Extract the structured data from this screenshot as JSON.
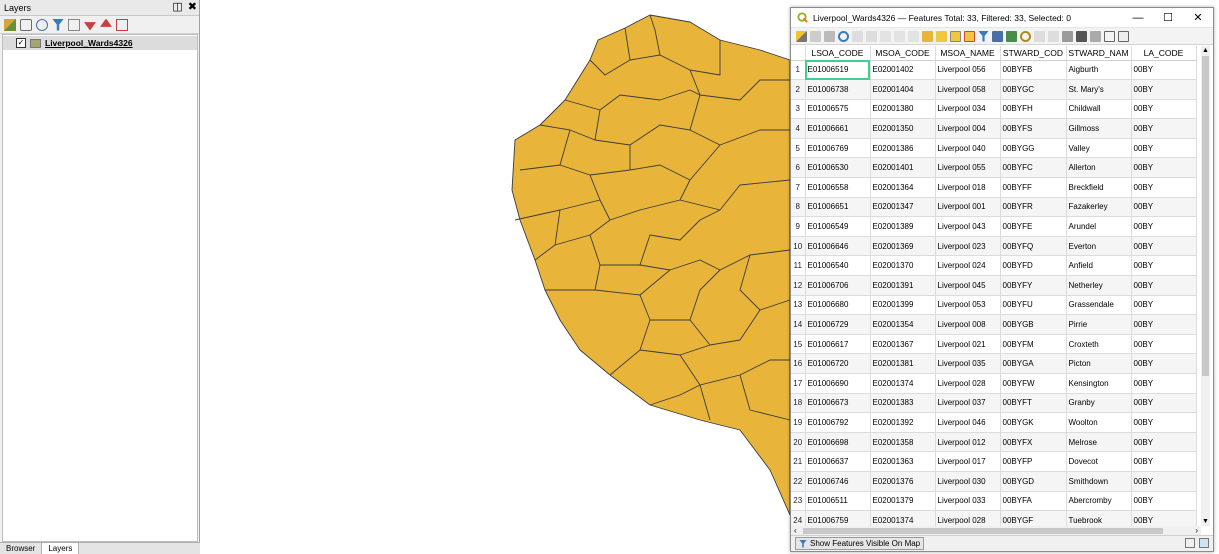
{
  "layers_panel": {
    "title": "Layers",
    "layer_name": "Liverpool_Wards4326",
    "tabs": [
      "Browser",
      "Layers"
    ]
  },
  "attribute_table": {
    "title": "Liverpool_Wards4326 — Features Total: 33, Filtered: 33, Selected: 0",
    "columns": [
      "LSOA_CODE",
      "MSOA_CODE",
      "MSOA_NAME",
      "STWARD_COD",
      "STWARD_NAM",
      "LA_CODE"
    ],
    "rows": [
      [
        "1",
        "E01006519",
        "E02001402",
        "Liverpool 056",
        "00BYFB",
        "Aigburth",
        "00BY"
      ],
      [
        "2",
        "E01006738",
        "E02001404",
        "Liverpool 058",
        "00BYGC",
        "St. Mary's",
        "00BY"
      ],
      [
        "3",
        "E01006575",
        "E02001380",
        "Liverpool 034",
        "00BYFH",
        "Childwall",
        "00BY"
      ],
      [
        "4",
        "E01006661",
        "E02001350",
        "Liverpool 004",
        "00BYFS",
        "Gillmoss",
        "00BY"
      ],
      [
        "5",
        "E01006769",
        "E02001386",
        "Liverpool 040",
        "00BYGG",
        "Valley",
        "00BY"
      ],
      [
        "6",
        "E01006530",
        "E02001401",
        "Liverpool 055",
        "00BYFC",
        "Allerton",
        "00BY"
      ],
      [
        "7",
        "E01006558",
        "E02001364",
        "Liverpool 018",
        "00BYFF",
        "Breckfield",
        "00BY"
      ],
      [
        "8",
        "E01006651",
        "E02001347",
        "Liverpool 001",
        "00BYFR",
        "Fazakerley",
        "00BY"
      ],
      [
        "9",
        "E01006549",
        "E02001389",
        "Liverpool 043",
        "00BYFE",
        "Arundel",
        "00BY"
      ],
      [
        "10",
        "E01006646",
        "E02001369",
        "Liverpool 023",
        "00BYFQ",
        "Everton",
        "00BY"
      ],
      [
        "11",
        "E01006540",
        "E02001370",
        "Liverpool 024",
        "00BYFD",
        "Anfield",
        "00BY"
      ],
      [
        "12",
        "E01006706",
        "E02001391",
        "Liverpool 045",
        "00BYFY",
        "Netherley",
        "00BY"
      ],
      [
        "13",
        "E01006680",
        "E02001399",
        "Liverpool 053",
        "00BYFU",
        "Grassendale",
        "00BY"
      ],
      [
        "14",
        "E01006729",
        "E02001354",
        "Liverpool 008",
        "00BYGB",
        "Pirrie",
        "00BY"
      ],
      [
        "15",
        "E01006617",
        "E02001367",
        "Liverpool 021",
        "00BYFM",
        "Croxteth",
        "00BY"
      ],
      [
        "16",
        "E01006720",
        "E02001381",
        "Liverpool 035",
        "00BYGA",
        "Picton",
        "00BY"
      ],
      [
        "17",
        "E01006690",
        "E02001374",
        "Liverpool 028",
        "00BYFW",
        "Kensington",
        "00BY"
      ],
      [
        "18",
        "E01006673",
        "E02001383",
        "Liverpool 037",
        "00BYFT",
        "Granby",
        "00BY"
      ],
      [
        "19",
        "E01006792",
        "E02001392",
        "Liverpool 046",
        "00BYGK",
        "Woolton",
        "00BY"
      ],
      [
        "20",
        "E01006698",
        "E02001358",
        "Liverpool 012",
        "00BYFX",
        "Melrose",
        "00BY"
      ],
      [
        "21",
        "E01006637",
        "E02001363",
        "Liverpool 017",
        "00BYFP",
        "Dovecot",
        "00BY"
      ],
      [
        "22",
        "E01006746",
        "E02001376",
        "Liverpool 030",
        "00BYGD",
        "Smithdown",
        "00BY"
      ],
      [
        "23",
        "E01006511",
        "E02001379",
        "Liverpool 033",
        "00BYFA",
        "Abercromby",
        "00BY"
      ],
      [
        "24",
        "E01006759",
        "E02001374",
        "Liverpool 028",
        "00BYGF",
        "Tuebrook",
        "00BY"
      ]
    ],
    "show_visible_label": "Show Features Visible On Map"
  },
  "colors": {
    "map_fill": "#e8b53a",
    "map_stroke": "#3b3b3b",
    "selected_cell": "#3fcf8e"
  }
}
